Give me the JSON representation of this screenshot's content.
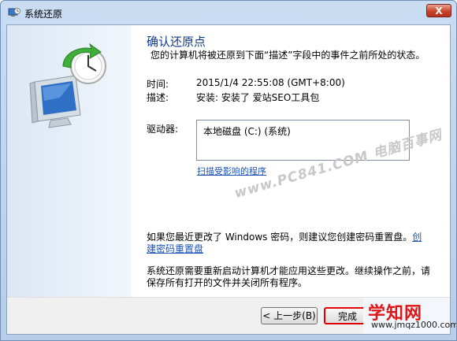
{
  "window": {
    "title": "系统还原",
    "close_glyph": "X"
  },
  "main": {
    "heading": "确认还原点",
    "description": "您的计算机将被还原到下面“描述”字段中的事件之前所处的状态。",
    "time_label": "时间:",
    "time_value": "2015/1/4 22:55:08 (GMT+8:00)",
    "desc_label": "描述:",
    "desc_value": "安装: 安装了 爱站SEO工具包",
    "drive_label": "驱动器:",
    "drives": [
      "本地磁盘 (C:) (系统)"
    ],
    "scan_link": "扫描受影响的程序",
    "watermark": "www.PC841.COM 电脑百事网",
    "password_note": "如果您最近更改了 Windows 密码，则建议您创建密码重置盘。",
    "password_link": "创建密码重置盘",
    "restart_note": "系统还原需要重新启动计算机才能应用这些更改。继续操作之前，请保存所有打开的文件并关闭所有程序。"
  },
  "footer": {
    "back_label": "< 上一步(B)",
    "finish_label": "完成"
  },
  "logo": {
    "main": "学知网",
    "sub": "www.jmqz1000.com"
  }
}
